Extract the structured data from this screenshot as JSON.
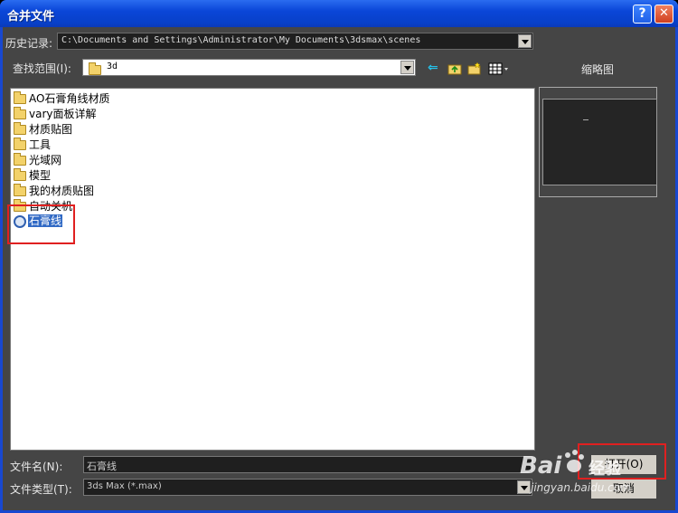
{
  "window": {
    "title": "合并文件",
    "help_label": "?",
    "close_label": "✕"
  },
  "history": {
    "label": "历史记录:",
    "path": "C:\\Documents and Settings\\Administrator\\My Documents\\3dsmax\\scenes"
  },
  "lookin": {
    "label": "查找范围(I):",
    "value": "3d"
  },
  "thumbnail": {
    "label": "缩略图"
  },
  "files": [
    {
      "name": "AO石膏角线材质",
      "type": "folder"
    },
    {
      "name": "vary面板详解",
      "type": "folder"
    },
    {
      "name": "材质贴图",
      "type": "folder"
    },
    {
      "name": "工具",
      "type": "folder"
    },
    {
      "name": "光域网",
      "type": "folder"
    },
    {
      "name": "模型",
      "type": "folder"
    },
    {
      "name": "我的材质贴图",
      "type": "folder"
    },
    {
      "name": "自动关机",
      "type": "folder"
    },
    {
      "name": "石膏线",
      "type": "max-file",
      "selected": true
    }
  ],
  "filename": {
    "label": "文件名(N):",
    "value": "石膏线"
  },
  "filetype": {
    "label": "文件类型(T):",
    "value": "3ds Max (*.max)"
  },
  "buttons": {
    "open": "打开(O)",
    "cancel": "取消"
  },
  "watermark": {
    "brand": "Bai",
    "brand_suffix": "经验",
    "url": "jingyan.baidu.com"
  },
  "colors": {
    "titlebar": "#0a46d8",
    "client_bg": "#454545",
    "selection": "#316ac5",
    "highlight_box": "#e02020"
  }
}
